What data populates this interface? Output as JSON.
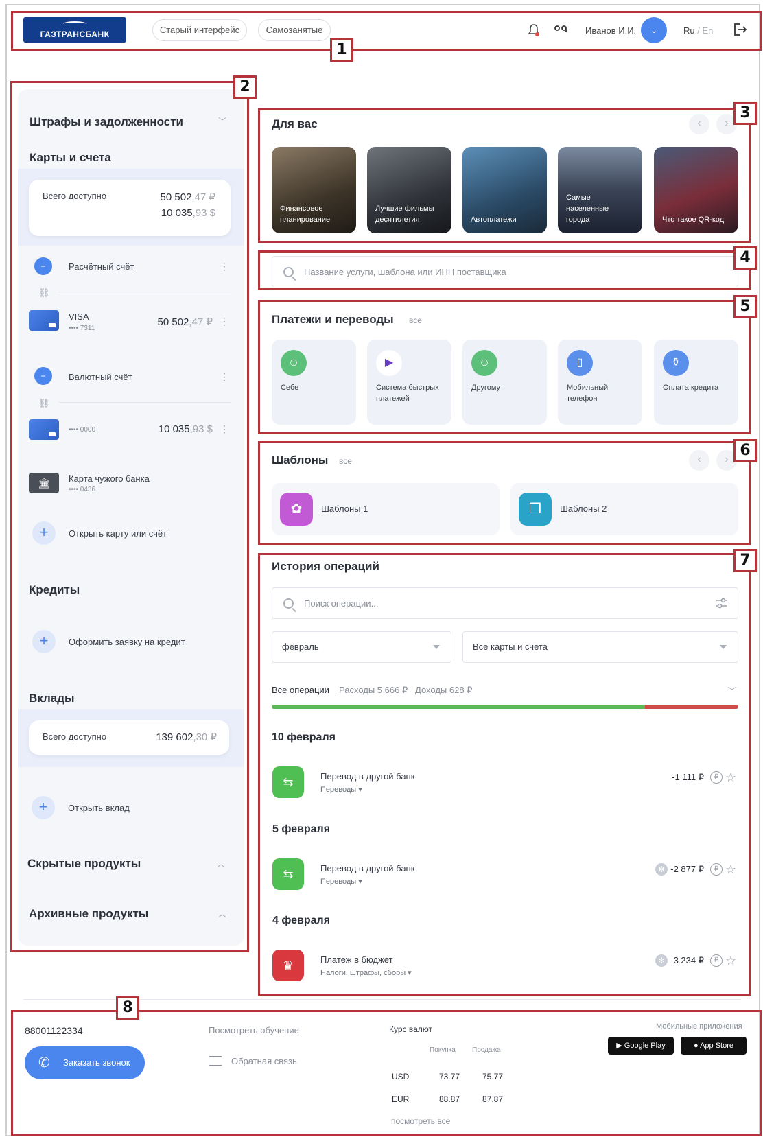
{
  "header": {
    "logo": "ГАЗТРАНСБАНК",
    "old_ui": "Старый интерфейс",
    "self_employed": "Самозанятые",
    "user": "Иванов И.И.",
    "lang_ru": "Ru",
    "lang_sep": " / ",
    "lang_en": "En"
  },
  "markers": [
    "1",
    "2",
    "3",
    "4",
    "5",
    "6",
    "7",
    "8"
  ],
  "sidebar": {
    "fines": "Штрафы и задолженности",
    "cards_title": "Карты и счета",
    "total_label": "Всего доступно",
    "total_rub_int": "50 502",
    "total_rub_dec": ",47 ₽",
    "total_usd_int": "10 035",
    "total_usd_dec": ",93 $",
    "account1": "Расчётный счёт",
    "card1_name": "VISA",
    "card1_num": "•••• 7311",
    "card1_int": "50 502",
    "card1_dec": ",47 ₽",
    "account2": "Валютный счёт",
    "card2_num": "•••• 0000",
    "card2_int": "10 035",
    "card2_dec": ",93 $",
    "foreign_card": "Карта чужого банка",
    "foreign_num": "•••• 0436",
    "open_card": "Открыть карту или счёт",
    "credits_title": "Кредиты",
    "credit_apply": "Оформить заявку на кредит",
    "deposits_title": "Вклады",
    "dep_label": "Всего доступно",
    "dep_int": "139 602",
    "dep_dec": ",30 ₽",
    "open_deposit": "Открыть вклад",
    "hidden": "Скрытые продукты",
    "archive": "Архивные продукты"
  },
  "for_you": {
    "title": "Для вас",
    "stories": [
      "Финансовое планирование",
      "Лучшие фильмы десятилетия",
      "Автоплатежи",
      "Самые населенные города",
      "Что такое QR-код"
    ]
  },
  "search": {
    "placeholder": "Название услуги, шаблона или ИНН поставщика"
  },
  "payments": {
    "title": "Платежи и переводы",
    "all": "все",
    "tiles": [
      "Себе",
      "Система быстрых платежей",
      "Другому",
      "Мобильный телефон",
      "Оплата кредита"
    ]
  },
  "templates": {
    "title": "Шаблоны",
    "all": "все",
    "items": [
      "Шаблоны 1",
      "Шаблоны 2"
    ]
  },
  "history": {
    "title": "История операций",
    "search_placeholder": "Поиск операции...",
    "month": "февраль",
    "accounts": "Все карты и счета",
    "all_ops": "Все операции",
    "expenses": "Расходы 5 666 ₽",
    "income": "Доходы 628 ₽",
    "expense_share": 0.8,
    "groups": [
      {
        "date": "10 февраля",
        "title": "Перевод в другой банк",
        "category": "Переводы",
        "amount": "-1 111 ₽"
      },
      {
        "date": "5 февраля",
        "title": "Перевод в другой банк",
        "category": "Переводы",
        "amount": "-2 877 ₽"
      },
      {
        "date": "4 февраля",
        "title": "Платеж в бюджет",
        "category": "Налоги, штрафы, сборы",
        "amount": "-3 234 ₽"
      }
    ]
  },
  "footer": {
    "phone": "88001122334",
    "call_btn": "Заказать звонок",
    "tutorial": "Посмотреть обучение",
    "feedback": "Обратная связь",
    "rates_title": "Курс валют",
    "buy": "Покупка",
    "sell": "Продажа",
    "rates": [
      {
        "cur": "USD",
        "buy": "73.77",
        "sell": "75.77"
      },
      {
        "cur": "EUR",
        "buy": "88.87",
        "sell": "87.87"
      }
    ],
    "see_all": "посмотреть все",
    "mobile_apps": "Мобильные приложения",
    "google_play": "Google Play",
    "app_store": "App Store"
  },
  "colors": {
    "accent": "#4a86ee",
    "marker": "#b5343a",
    "income": "#5bb85a",
    "expense": "#cf4b4b"
  }
}
